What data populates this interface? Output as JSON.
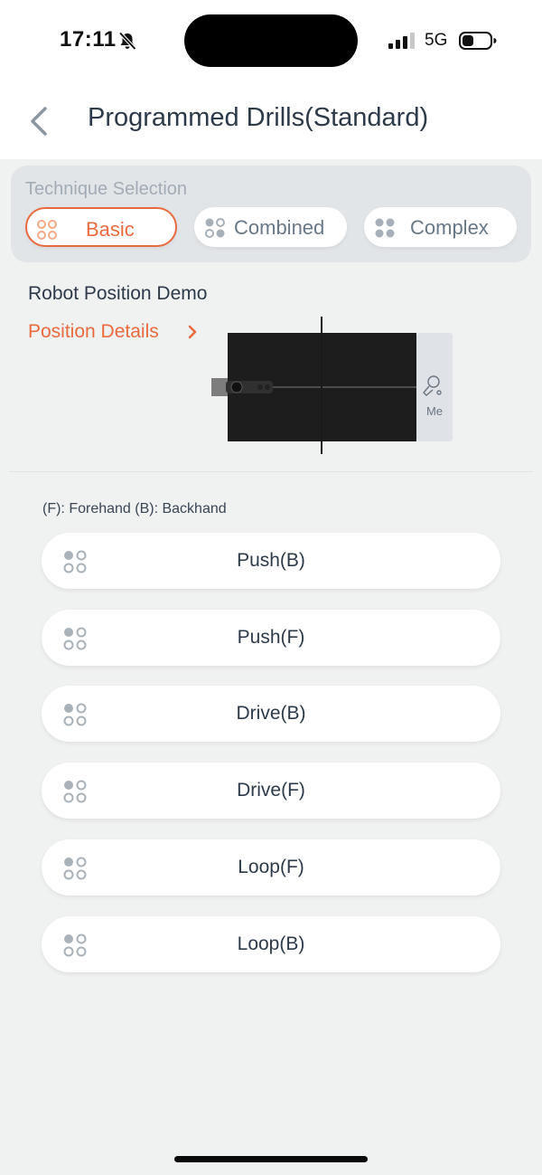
{
  "status_bar": {
    "time": "17:11",
    "network": "5G"
  },
  "header": {
    "title": "Programmed Drills(Standard)"
  },
  "technique": {
    "label": "Technique Selection",
    "options": [
      "Basic",
      "Combined",
      "Complex"
    ],
    "selected": "Basic"
  },
  "demo": {
    "title": "Robot Position Demo",
    "details_link": "Position Details",
    "player_label": "Me"
  },
  "legend": "(F): Forehand  (B): Backhand",
  "drills": [
    "Push(B)",
    "Push(F)",
    "Drive(B)",
    "Drive(F)",
    "Loop(F)",
    "Loop(B)"
  ],
  "colors": {
    "accent": "#ea6a3f",
    "text": "#2d3a4a",
    "background": "#f0f1f1"
  }
}
